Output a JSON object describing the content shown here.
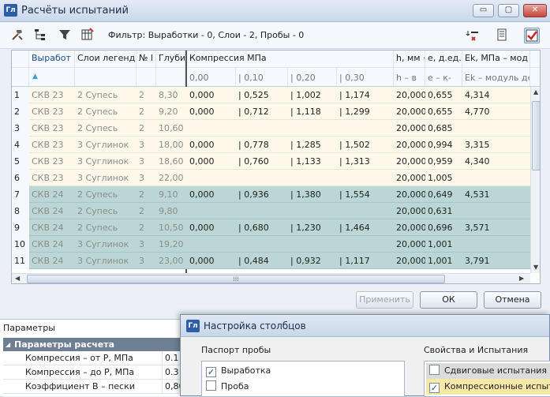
{
  "window": {
    "app_icon": "Гл",
    "title": "Расчёты испытаний",
    "controls": [
      "▭",
      "▢",
      "✕"
    ]
  },
  "toolbar": {
    "icons": [
      "hammer-icon",
      "tree-icon",
      "filter-icon",
      "column-settings-icon"
    ],
    "filter_text": "Фильтр: Выработки - 0, Слои - 2, Пробы - 0",
    "right_icons": [
      "sort-remove-icon",
      "report-icon",
      "checkmark-toggle-icon"
    ]
  },
  "grid": {
    "columns": [
      "Выработ",
      "Слои легенд",
      "№ l",
      "Глуби",
      "Компрессия МПа",
      "h, мм ·",
      "e, д.ед.",
      "Ek, МПа – мод"
    ],
    "compress_subheaders": [
      "0,00",
      "| 0,10",
      "| 0,20",
      "| 0,30"
    ],
    "sub_headers": [
      "h – в",
      "e – к-",
      "Ek – модуль де"
    ],
    "rows": [
      {
        "n": "1",
        "w": "СКВ 23",
        "layer": "2 Супесь",
        "num": "2",
        "depth": "8,30",
        "c0": "0,000",
        "c1": "| 0,525",
        "c2": "| 1,002",
        "c3": "| 1,174",
        "h": "20,000",
        "e": "0,655",
        "ek": "4,314",
        "color": "cream"
      },
      {
        "n": "2",
        "w": "СКВ 23",
        "layer": "2 Супесь",
        "num": "2",
        "depth": "9,20",
        "c0": "0,000",
        "c1": "| 0,712",
        "c2": "| 1,118",
        "c3": "| 1,299",
        "h": "20,000",
        "e": "0,655",
        "ek": "4,770",
        "color": "cream"
      },
      {
        "n": "3",
        "w": "СКВ 23",
        "layer": "2 Супесь",
        "num": "2",
        "depth": "10,60",
        "c0": "",
        "c1": "",
        "c2": "",
        "c3": "",
        "h": "20,000",
        "e": "0,685",
        "ek": "",
        "color": "cream"
      },
      {
        "n": "4",
        "w": "СКВ 23",
        "layer": "3 Суглинок",
        "num": "3",
        "depth": "18,00",
        "c0": "0,000",
        "c1": "| 0,778",
        "c2": "| 1,285",
        "c3": "| 1,502",
        "h": "20,000",
        "e": "0,994",
        "ek": "3,315",
        "color": "cream"
      },
      {
        "n": "5",
        "w": "СКВ 23",
        "layer": "3 Суглинок",
        "num": "3",
        "depth": "18,60",
        "c0": "0,000",
        "c1": "| 0,760",
        "c2": "| 1,133",
        "c3": "| 1,313",
        "h": "20,000",
        "e": "0,959",
        "ek": "4,340",
        "color": "cream"
      },
      {
        "n": "6",
        "w": "СКВ 23",
        "layer": "3 Суглинок",
        "num": "3",
        "depth": "22,00",
        "c0": "",
        "c1": "",
        "c2": "",
        "c3": "",
        "h": "20,000",
        "e": "1,005",
        "ek": "",
        "color": "cream"
      },
      {
        "n": "7",
        "w": "СКВ 24",
        "layer": "2 Супесь",
        "num": "2",
        "depth": "9,10",
        "c0": "0,000",
        "c1": "| 0,936",
        "c2": "| 1,380",
        "c3": "| 1,554",
        "h": "20,000",
        "e": "0,649",
        "ek": "4,531",
        "color": "teal"
      },
      {
        "n": "8",
        "w": "СКВ 24",
        "layer": "2 Супесь",
        "num": "2",
        "depth": "9,80",
        "c0": "",
        "c1": "",
        "c2": "",
        "c3": "",
        "h": "20,000",
        "e": "0,631",
        "ek": "",
        "color": "teal"
      },
      {
        "n": "9",
        "w": "СКВ 24",
        "layer": "2 Супесь",
        "num": "2",
        "depth": "10,50",
        "c0": "0,000",
        "c1": "| 0,680",
        "c2": "| 1,230",
        "c3": "| 1,464",
        "h": "20,000",
        "e": "0,696",
        "ek": "3,571",
        "color": "teal"
      },
      {
        "n": "10",
        "w": "СКВ 24",
        "layer": "3 Суглинок",
        "num": "3",
        "depth": "19,20",
        "c0": "",
        "c1": "",
        "c2": "",
        "c3": "",
        "h": "20,000",
        "e": "1,001",
        "ek": "",
        "color": "teal"
      },
      {
        "n": "11",
        "w": "СКВ 24",
        "layer": "3 Суглинок",
        "num": "3",
        "depth": "23,00",
        "c0": "0,000",
        "c1": "| 0,484",
        "c2": "| 0,932",
        "c3": "| 1,117",
        "h": "20,000",
        "e": "1,001",
        "ek": "3,791",
        "color": "teal"
      }
    ],
    "hscroll_grip": "⁞⁞⁞"
  },
  "buttons": {
    "apply": "Применить",
    "ok": "ОК",
    "cancel": "Отмена"
  },
  "params": {
    "title": "Параметры",
    "group": "Параметры расчета",
    "group_toggle": "◢",
    "rows": [
      {
        "name": "Компрессия – от P, МПа",
        "value": "0.1"
      },
      {
        "name": "Компрессия – до P, МПа",
        "value": "0.3"
      },
      {
        "name": "Коэффициент В – пески",
        "value": "0,80"
      }
    ]
  },
  "dialog": {
    "app_icon": "Гл",
    "title": "Настройка столбцов",
    "left_section": "Паспорт пробы",
    "left_items": [
      {
        "label": "Выработка",
        "checked": true
      },
      {
        "label": "Проба",
        "checked": false
      }
    ],
    "right_section": "Свойства и Испытания",
    "right_items": [
      {
        "label": "Сдвиговые испытания",
        "checked": false
      },
      {
        "label": "Компрессионные испыт",
        "checked": true
      }
    ]
  }
}
